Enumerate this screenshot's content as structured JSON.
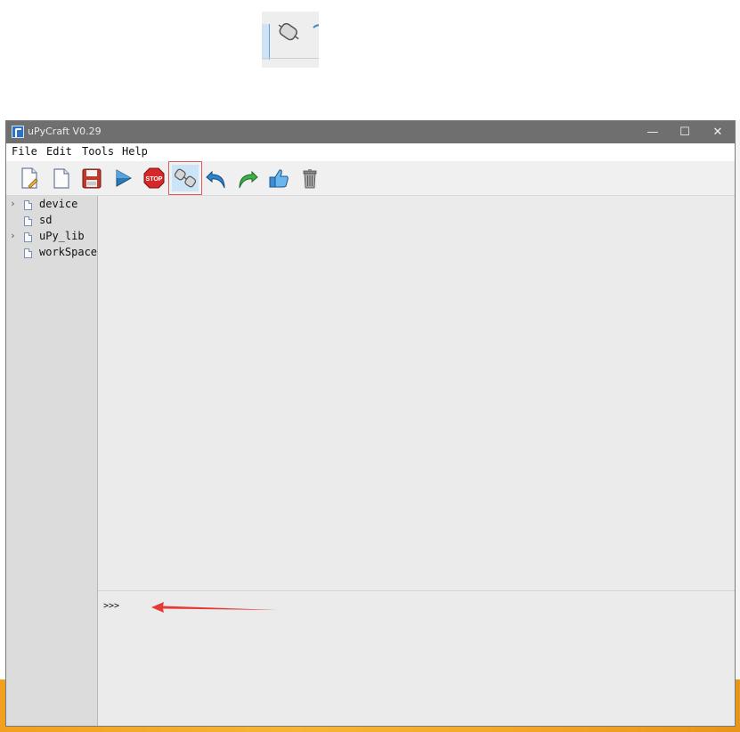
{
  "window": {
    "title": "uPyCraft V0.29",
    "controls": {
      "minimize": "—",
      "maximize": "☐",
      "close": "✕"
    }
  },
  "menu": [
    "File",
    "Edit",
    "Tools",
    "Help"
  ],
  "toolbar": [
    {
      "icon": "new-file-icon"
    },
    {
      "icon": "open-file-icon"
    },
    {
      "icon": "save-icon"
    },
    {
      "icon": "run-icon"
    },
    {
      "icon": "stop-icon",
      "text": "STOP"
    },
    {
      "icon": "connect-icon",
      "active": true
    },
    {
      "icon": "undo-icon"
    },
    {
      "icon": "redo-icon"
    },
    {
      "icon": "syntax-check-icon"
    },
    {
      "icon": "clear-icon"
    }
  ],
  "file_tree": [
    {
      "label": "device",
      "expandable": true
    },
    {
      "label": "sd",
      "expandable": false
    },
    {
      "label": "uPy_lib",
      "expandable": true
    },
    {
      "label": "workSpace",
      "expandable": false
    }
  ],
  "terminal": {
    "prompt": ">>>"
  },
  "colors": {
    "titlebar": "#6f6f6f",
    "annotation_arrow": "#e53935",
    "active_tool_highlight": "#cce4f7",
    "active_tool_border": "#e05a5a"
  }
}
